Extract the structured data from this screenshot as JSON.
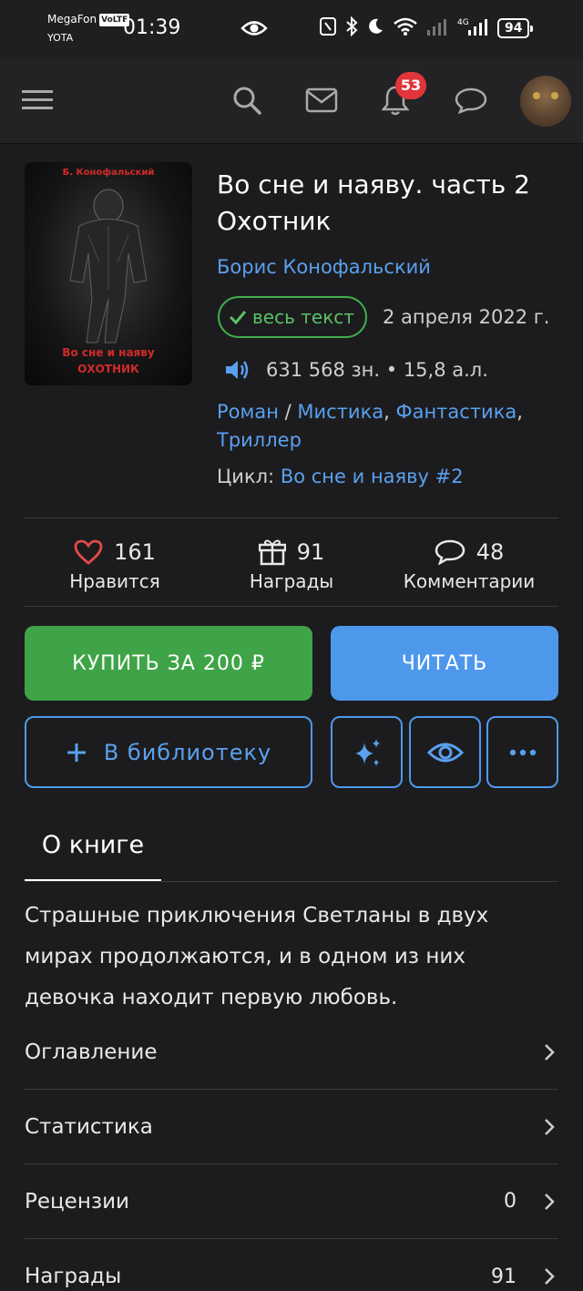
{
  "status_bar": {
    "carrier": "MegaFon",
    "volte": "VoLTE",
    "carrier2": "YOTA",
    "time": "01:39",
    "battery": "94"
  },
  "topbar": {
    "notifications_count": "53"
  },
  "cover": {
    "author": "Б. Конофальский",
    "title_line1": "Во сне и наяву",
    "title_line2": "ОХОТНИК"
  },
  "book": {
    "title": "Во сне и наяву. часть 2 Охотник",
    "author": "Борис Конофальский",
    "status": "весь текст",
    "date": "2 апреля 2022 г.",
    "size": "631 568 зн. • 15,8 а.л.",
    "genres": [
      {
        "label": "Роман",
        "sep": " / "
      },
      {
        "label": "Мистика",
        "sep": ", "
      },
      {
        "label": "Фантастика",
        "sep": ","
      },
      {
        "label": "Триллер",
        "sep": ""
      }
    ],
    "cycle_label": "Цикл:",
    "cycle_value": "Во сне и наяву #2"
  },
  "stats": {
    "likes": "161",
    "likes_label": "Нравится",
    "awards": "91",
    "awards_label": "Награды",
    "comments": "48",
    "comments_label": "Комментарии"
  },
  "actions": {
    "buy": "КУПИТЬ ЗА 200 ₽",
    "read": "ЧИТАТЬ",
    "library": "В библиотеку"
  },
  "tabs": {
    "about": "О книге"
  },
  "description": "Страшные приключения Светланы в двух мирах продолжаются, и в одном из них девочка находит первую любовь.",
  "rows": [
    {
      "label": "Оглавление",
      "value": ""
    },
    {
      "label": "Статистика",
      "value": ""
    },
    {
      "label": "Рецензии",
      "value": "0"
    },
    {
      "label": "Награды",
      "value": "91"
    }
  ],
  "colors": {
    "background": "#1c1c1e",
    "accent_blue": "#4e98ec",
    "buy_green": "#3fa447",
    "badge_red": "#e0353b"
  }
}
